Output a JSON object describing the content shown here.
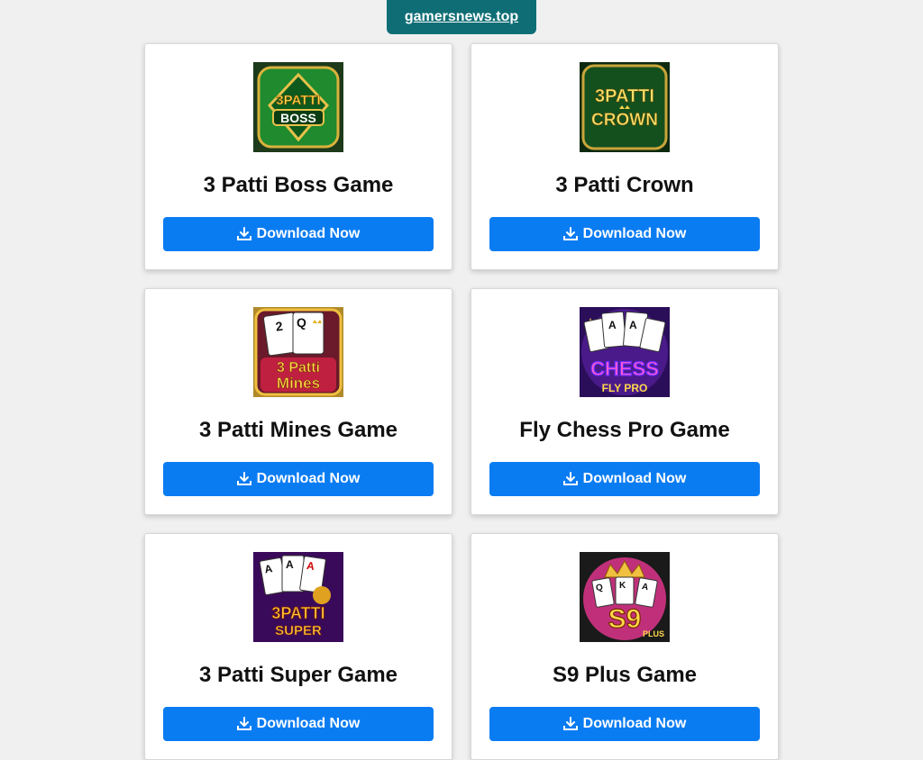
{
  "header": {
    "site_link": "gamersnews.top"
  },
  "games": [
    {
      "title": "3 Patti Boss Game",
      "button_label": "Download Now",
      "icon": "3patti-boss-logo",
      "icon_text": [
        "3PATTI",
        "BOSS"
      ]
    },
    {
      "title": "3 Patti Crown",
      "button_label": "Download Now",
      "icon": "3patti-crown-logo",
      "icon_text": [
        "3PATTI",
        "CROWN"
      ]
    },
    {
      "title": "3 Patti Mines Game",
      "button_label": "Download Now",
      "icon": "3patti-mines-logo",
      "icon_text": [
        "3 Patti",
        "Mines"
      ]
    },
    {
      "title": "Fly Chess Pro Game",
      "button_label": "Download Now",
      "icon": "fly-chess-pro-logo",
      "icon_text": [
        "CHESS",
        "FLY PRO"
      ]
    },
    {
      "title": "3 Patti Super Game",
      "button_label": "Download Now",
      "icon": "3patti-super-logo",
      "icon_text": [
        "3PATTI",
        "SUPER"
      ]
    },
    {
      "title": "S9 Plus Game",
      "button_label": "Download Now",
      "icon": "s9-plus-logo",
      "icon_text": [
        "S9",
        "PLUS"
      ]
    }
  ],
  "colors": {
    "page_bg": "#f0f0f0",
    "badge_bg": "#0f6e75",
    "button_bg": "#0a7cf2",
    "title_text": "#111111"
  }
}
